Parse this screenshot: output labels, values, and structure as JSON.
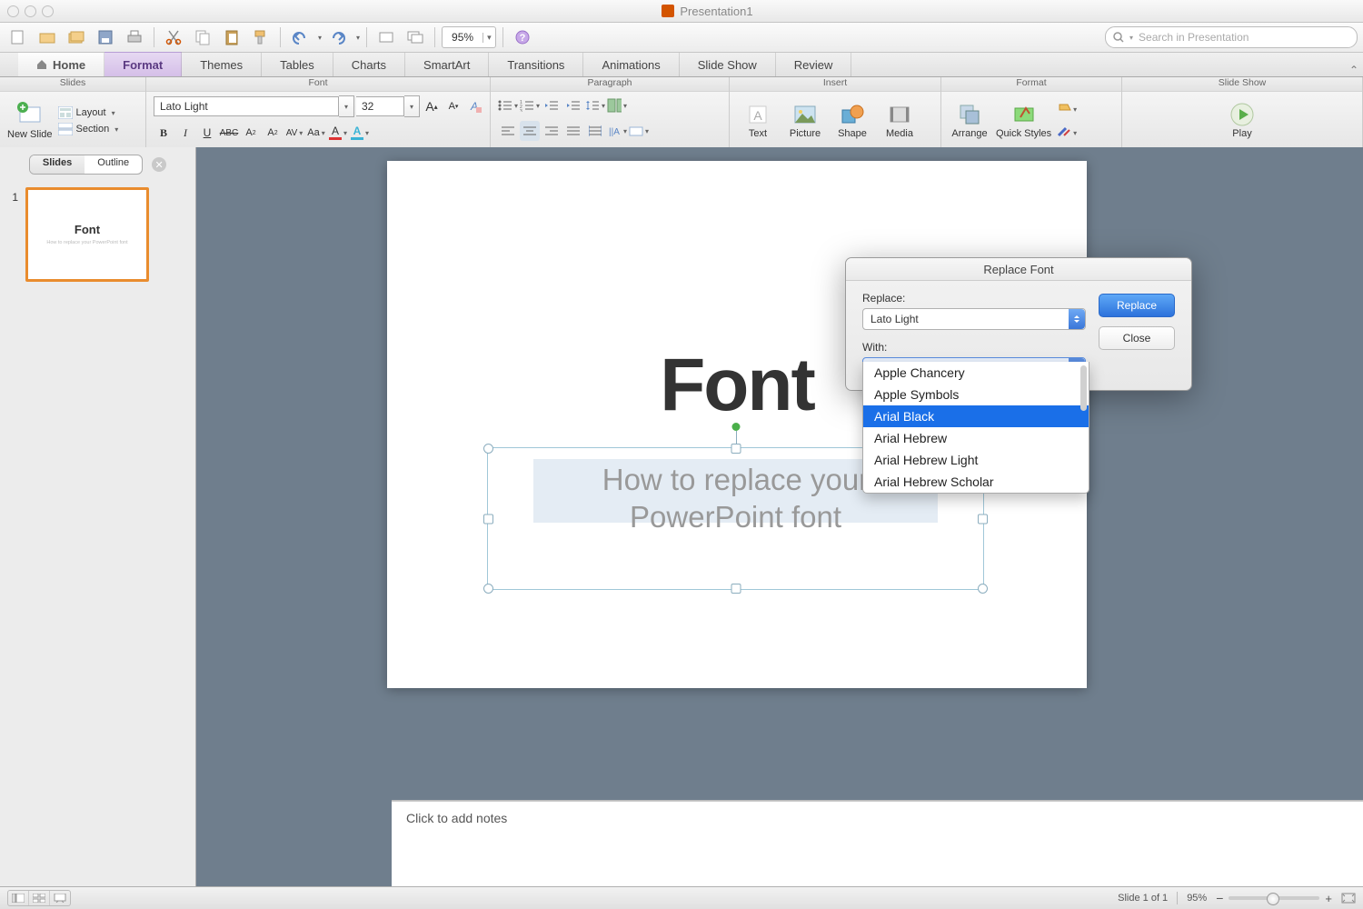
{
  "window": {
    "title": "Presentation1"
  },
  "qat": {
    "zoom": "95%",
    "search_placeholder": "Search in Presentation"
  },
  "tabs": {
    "home": "Home",
    "list": [
      "Format",
      "Themes",
      "Tables",
      "Charts",
      "SmartArt",
      "Transitions",
      "Animations",
      "Slide Show",
      "Review"
    ]
  },
  "ribbon": {
    "groups": {
      "slides": "Slides",
      "font": "Font",
      "paragraph": "Paragraph",
      "insert": "Insert",
      "format": "Format",
      "slideshow": "Slide Show"
    },
    "slides": {
      "new_slide": "New Slide",
      "layout": "Layout",
      "section": "Section"
    },
    "font": {
      "name": "Lato Light",
      "size": "32"
    },
    "insert": {
      "text": "Text",
      "picture": "Picture",
      "shape": "Shape",
      "media": "Media"
    },
    "format": {
      "arrange": "Arrange",
      "quick_styles": "Quick Styles"
    },
    "slideshow": {
      "play": "Play"
    }
  },
  "side": {
    "tabs": {
      "slides": "Slides",
      "outline": "Outline"
    },
    "slide_num": "1",
    "thumb_title": "Font",
    "thumb_sub": "How to replace your PowerPoint font"
  },
  "slide": {
    "title": "Font",
    "subtitle1": "How to replace your",
    "subtitle2": "PowerPoint font"
  },
  "notes": {
    "placeholder": "Click to add notes"
  },
  "dialog": {
    "title": "Replace Font",
    "replace_label": "Replace:",
    "replace_value": "Lato Light",
    "with_label": "With:",
    "with_value": "Arial Black",
    "btn_replace": "Replace",
    "btn_close": "Close",
    "options": [
      "Apple Chancery",
      "Apple Symbols",
      "Arial Black",
      "Arial Hebrew",
      "Arial Hebrew Light",
      "Arial Hebrew Scholar"
    ],
    "selected_index": 2
  },
  "status": {
    "slide_of": "Slide 1 of 1",
    "zoom": "95%"
  }
}
